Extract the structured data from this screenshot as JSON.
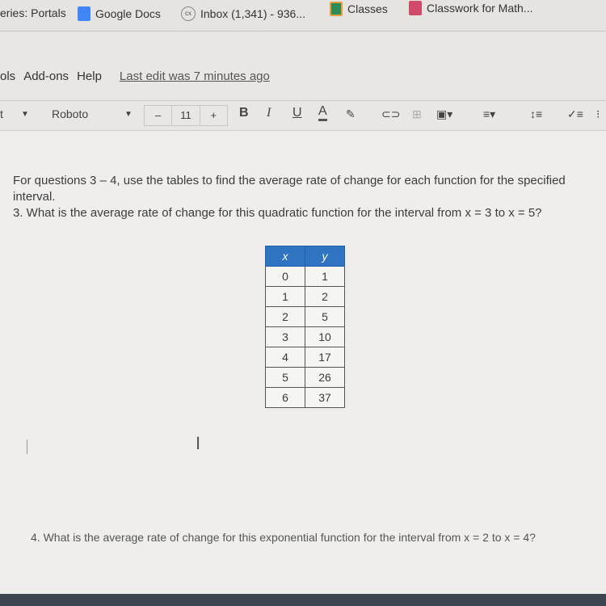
{
  "bookmarks": [
    {
      "label": "eries: Portals",
      "icon": "none"
    },
    {
      "label": "Google Docs",
      "icon": "docs-icon"
    },
    {
      "label": "Inbox (1,341) - 936...",
      "icon": "cx-icon"
    },
    {
      "label": "Classes",
      "icon": "classroom-icon"
    },
    {
      "label": "Classwork for Math...",
      "icon": "classwork-icon"
    }
  ],
  "menu": {
    "items": [
      "ols",
      "Add-ons",
      "Help"
    ],
    "last_edit": "Last edit was 7 minutes ago"
  },
  "toolbar": {
    "style": "t",
    "font": "Roboto",
    "minus": "–",
    "size": "11",
    "plus": "+",
    "bold": "B",
    "italic": "I",
    "underline": "U",
    "text_color": "A"
  },
  "document": {
    "line1": "For questions 3 – 4, use the tables to find the average rate of change for each function for the specified interval.",
    "line2": "3. What is the average rate of change for this quadratic function for the interval from x = 3 to x = 5?",
    "table": {
      "headers": [
        "x",
        "y"
      ],
      "rows": [
        [
          "0",
          "1"
        ],
        [
          "1",
          "2"
        ],
        [
          "2",
          "5"
        ],
        [
          "3",
          "10"
        ],
        [
          "4",
          "17"
        ],
        [
          "5",
          "26"
        ],
        [
          "6",
          "37"
        ]
      ]
    },
    "question4": "4. What is the average rate of change for this exponential function for the interval from x = 2 to x = 4?"
  },
  "colors": {
    "table_header": "#2f74c0",
    "docs_blue": "#4285f4"
  }
}
